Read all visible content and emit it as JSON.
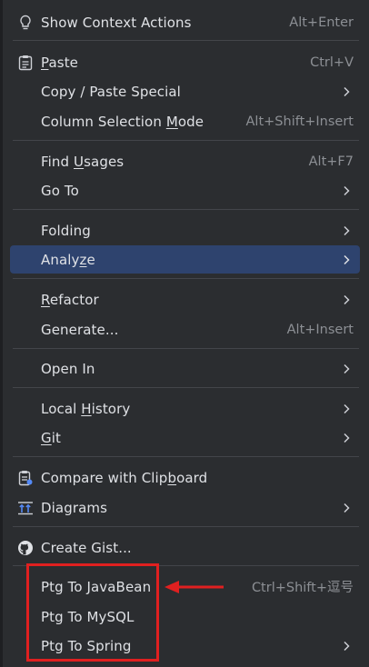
{
  "menu": {
    "items": [
      {
        "pre": "",
        "ul": "",
        "post": "Show Context Actions",
        "shortcut": "Alt+Enter",
        "icon": "lightbulb-icon"
      },
      {
        "pre": "",
        "ul": "P",
        "post": "aste",
        "shortcut": "Ctrl+V",
        "icon": "clipboard-icon"
      },
      {
        "pre": "",
        "ul": "",
        "post": "Copy / Paste Special",
        "shortcut": ""
      },
      {
        "pre": "Column Selection ",
        "ul": "M",
        "post": "ode",
        "shortcut": "Alt+Shift+Insert"
      },
      {
        "pre": "Find ",
        "ul": "U",
        "post": "sages",
        "shortcut": "Alt+F7"
      },
      {
        "pre": "",
        "ul": "",
        "post": "Go To",
        "shortcut": ""
      },
      {
        "pre": "",
        "ul": "",
        "post": "Folding",
        "shortcut": ""
      },
      {
        "pre": "Analy",
        "ul": "z",
        "post": "e",
        "shortcut": ""
      },
      {
        "pre": "",
        "ul": "R",
        "post": "efactor",
        "shortcut": ""
      },
      {
        "pre": "",
        "ul": "",
        "post": "Generate...",
        "shortcut": "Alt+Insert"
      },
      {
        "pre": "",
        "ul": "",
        "post": "Open In",
        "shortcut": ""
      },
      {
        "pre": "Local ",
        "ul": "H",
        "post": "istory",
        "shortcut": ""
      },
      {
        "pre": "",
        "ul": "G",
        "post": "it",
        "shortcut": ""
      },
      {
        "pre": "Compare with Clip",
        "ul": "b",
        "post": "oard",
        "shortcut": "",
        "icon": "compare-clipboard-icon"
      },
      {
        "pre": "",
        "ul": "",
        "post": "Diagrams",
        "shortcut": "",
        "icon": "diagram-icon"
      },
      {
        "pre": "",
        "ul": "",
        "post": "Create Gist...",
        "shortcut": "",
        "icon": "github-icon"
      },
      {
        "pre": "",
        "ul": "",
        "post": "Ptg To JavaBean",
        "shortcut": "Ctrl+Shift+逗号"
      },
      {
        "pre": "",
        "ul": "",
        "post": "Ptg To MySQL",
        "shortcut": ""
      },
      {
        "pre": "",
        "ul": "",
        "post": "Ptg To Spring",
        "shortcut": ""
      }
    ]
  },
  "colors": {
    "background": "#2b2d30",
    "selected": "#2e436e",
    "text": "#dfe1e5",
    "shortcut": "#8c8f94",
    "highlight": "#e02020"
  }
}
